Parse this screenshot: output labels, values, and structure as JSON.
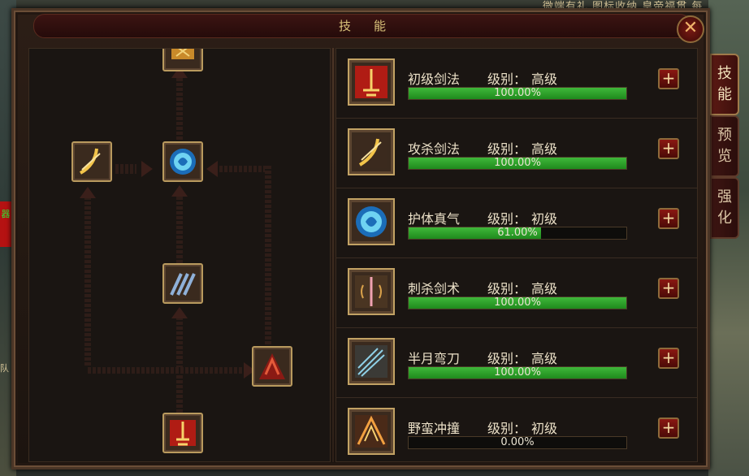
{
  "background": {
    "top_text": "微端有礼  图标收纳    皇帝福贯   每",
    "left_badge": "器",
    "left_text": "队"
  },
  "window": {
    "title": "技能",
    "close_label": "✕"
  },
  "side_tabs": [
    {
      "chars": [
        "技",
        "能"
      ],
      "active": true
    },
    {
      "chars": [
        "预",
        "览"
      ],
      "active": false
    },
    {
      "chars": [
        "强",
        "化"
      ],
      "active": false
    }
  ],
  "level_label": "级别：",
  "skills": [
    {
      "name": "初级剑法",
      "level": "高级",
      "progress": 1.0,
      "progress_text": "100.00%",
      "icon": "sword-basic-icon",
      "plus": "+"
    },
    {
      "name": "攻杀剑法",
      "level": "高级",
      "progress": 1.0,
      "progress_text": "100.00%",
      "icon": "slash-arc-icon",
      "plus": "+"
    },
    {
      "name": "护体真气",
      "level": "初级",
      "progress": 0.61,
      "progress_text": "61.00%",
      "icon": "shield-aura-icon",
      "plus": "+"
    },
    {
      "name": "刺杀剑术",
      "level": "高级",
      "progress": 1.0,
      "progress_text": "100.00%",
      "icon": "thrust-sword-icon",
      "plus": "+"
    },
    {
      "name": "半月弯刀",
      "level": "高级",
      "progress": 1.0,
      "progress_text": "100.00%",
      "icon": "crescent-blade-icon",
      "plus": "+"
    },
    {
      "name": "野蛮冲撞",
      "level": "初级",
      "progress": 0.0,
      "progress_text": "0.00%",
      "icon": "savage-charge-icon",
      "plus": "+"
    }
  ],
  "colors": {
    "progress_green": "#2ea42a",
    "accent_gold": "#c2a264",
    "button_red": "#8a1812"
  }
}
